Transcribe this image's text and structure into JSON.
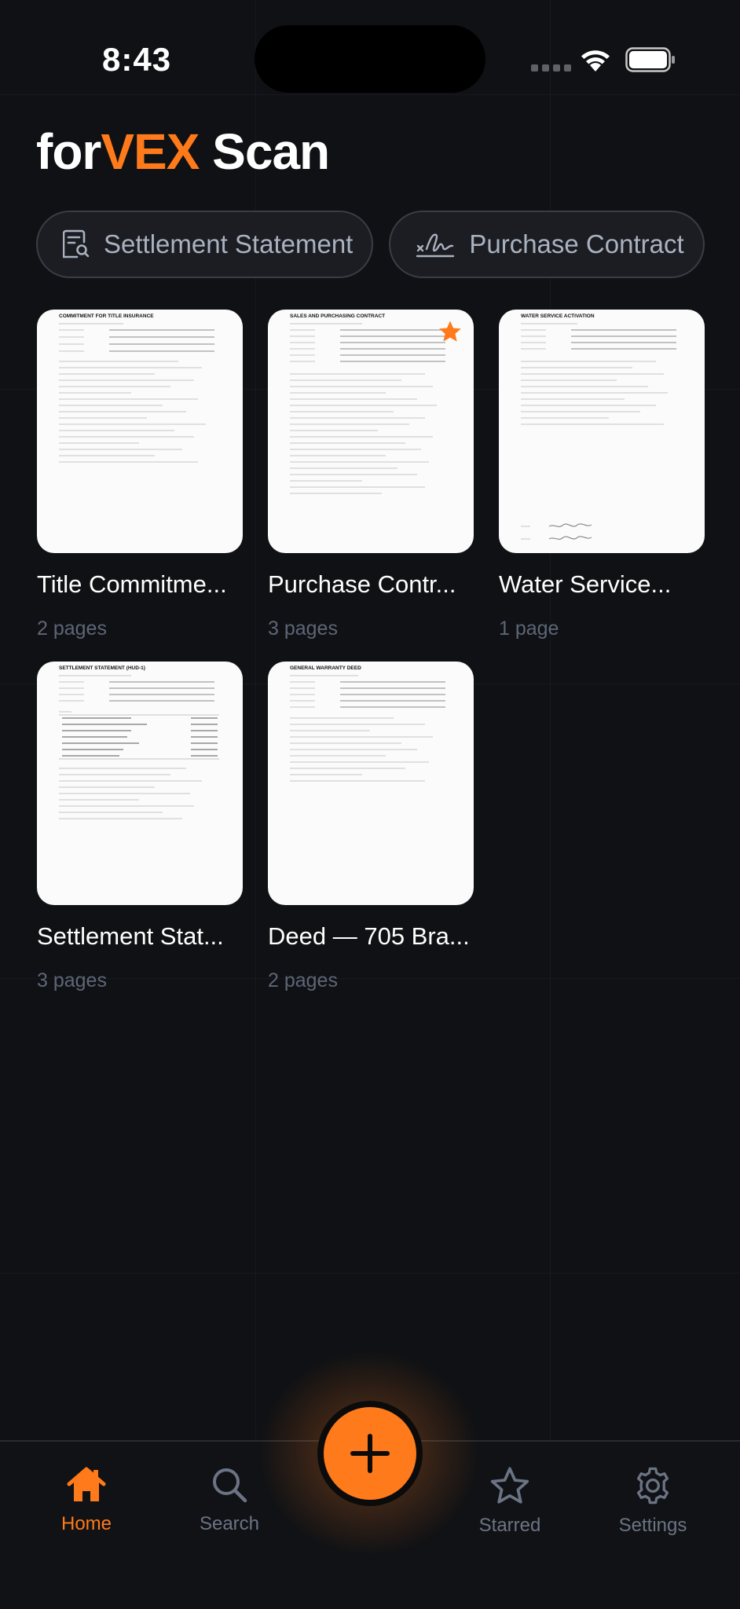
{
  "status_bar": {
    "time": "8:43"
  },
  "app": {
    "title_prefix": "for",
    "title_accent": "VEX",
    "title_suffix": " Scan"
  },
  "chips": [
    {
      "label": "Settlement Statement",
      "icon": "receipt-search-icon"
    },
    {
      "label": "Purchase Contract",
      "icon": "signature-icon"
    }
  ],
  "documents": [
    {
      "title": "Title Commitme...",
      "pages": "2 pages",
      "starred": false,
      "thumb_heading": "COMMITMENT FOR TITLE INSURANCE"
    },
    {
      "title": "Purchase Contr...",
      "pages": "3 pages",
      "starred": true,
      "thumb_heading": "SALES AND PURCHASING CONTRACT"
    },
    {
      "title": "Water Service...",
      "pages": "1 page",
      "starred": false,
      "thumb_heading": "WATER SERVICE ACTIVATION"
    },
    {
      "title": "Settlement Stat...",
      "pages": "3 pages",
      "starred": false,
      "thumb_heading": "SETTLEMENT STATEMENT (HUD-1)"
    },
    {
      "title": "Deed — 705 Bra...",
      "pages": "2 pages",
      "starred": false,
      "thumb_heading": "GENERAL WARRANTY DEED"
    }
  ],
  "tab_bar": {
    "home": "Home",
    "search": "Search",
    "starred": "Starred",
    "settings": "Settings"
  },
  "colors": {
    "accent": "#ff7a1a",
    "background": "#101114",
    "muted": "#5d6677"
  }
}
